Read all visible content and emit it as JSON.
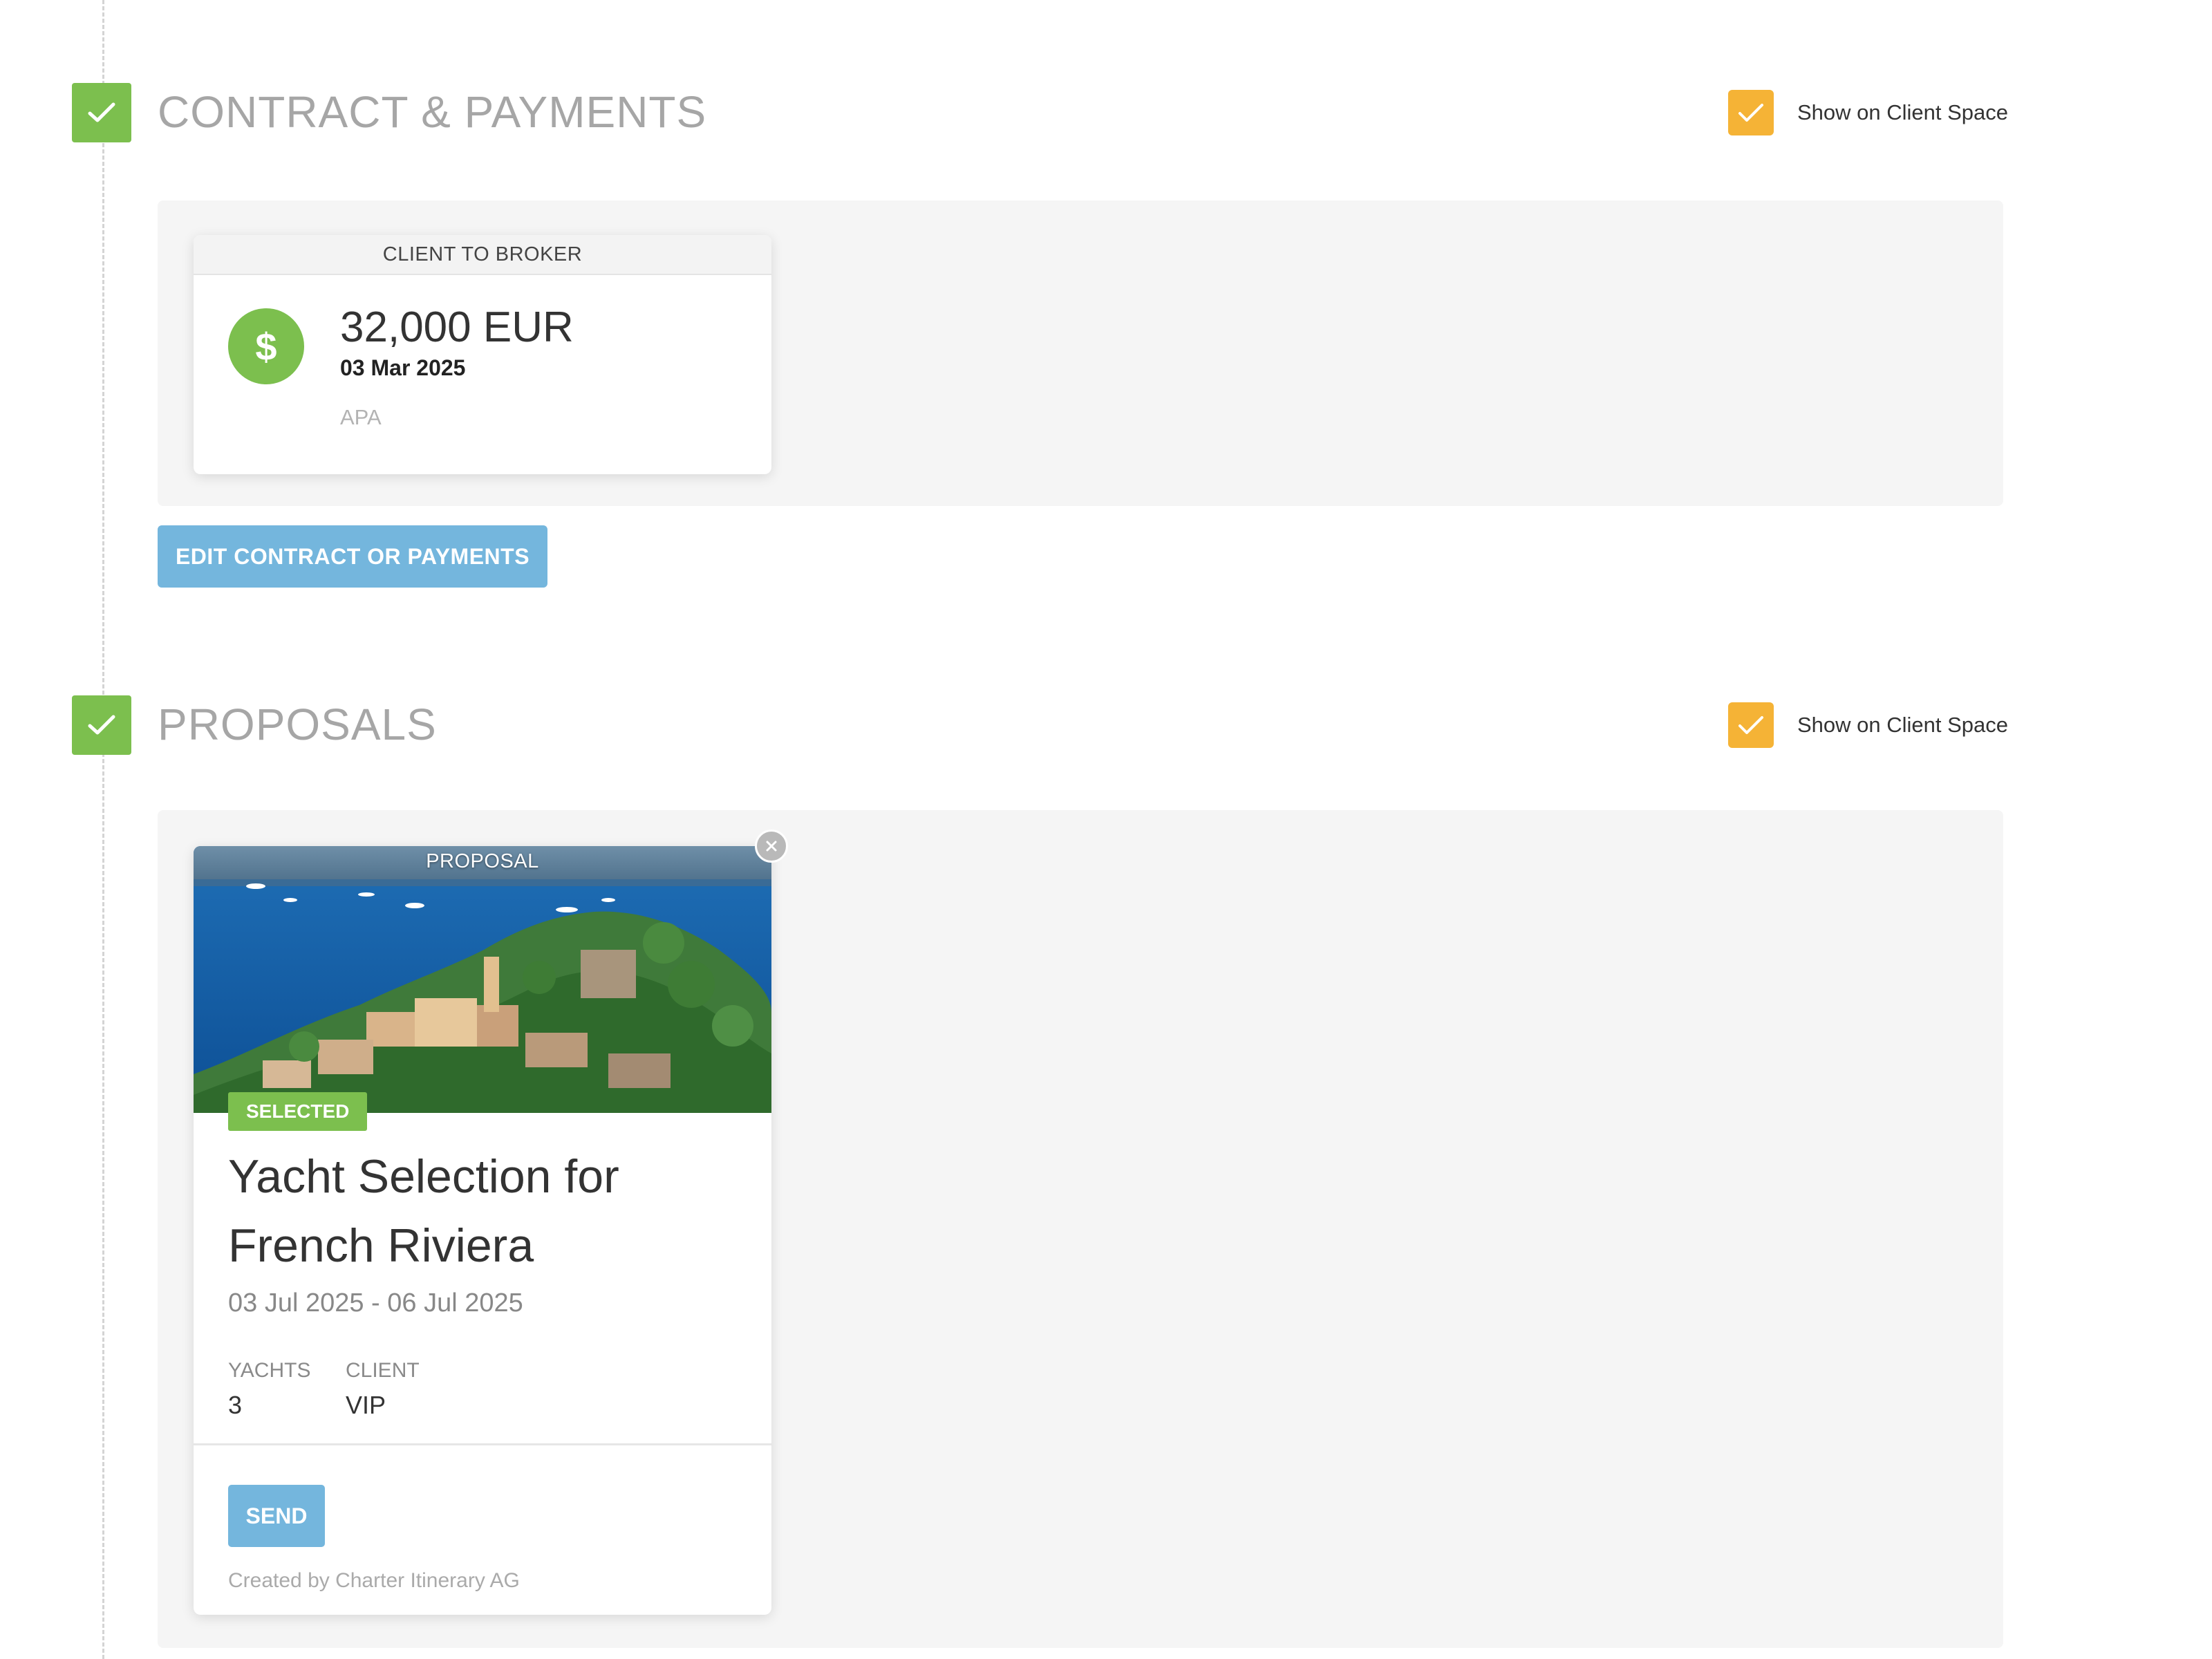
{
  "contract_section": {
    "title": "CONTRACT & PAYMENTS",
    "show_on_client_space_label": "Show on Client Space",
    "payment_card": {
      "header": "CLIENT TO BROKER",
      "amount": "32,000 EUR",
      "date": "03 Mar 2025",
      "type": "APA",
      "icon": "dollar-icon"
    },
    "edit_button_label": "EDIT CONTRACT OR PAYMENTS"
  },
  "proposals_section": {
    "title": "PROPOSALS",
    "show_on_client_space_label": "Show on Client Space",
    "proposal_card": {
      "image_label": "PROPOSAL",
      "badge": "SELECTED",
      "title": "Yacht Selection for French Riviera",
      "dates": "03 Jul 2025 - 06 Jul 2025",
      "yachts_label": "YACHTS",
      "yachts_value": "3",
      "client_label": "CLIENT",
      "client_value": "VIP",
      "send_button_label": "SEND",
      "created_by": "Created by Charter Itinerary AG"
    }
  },
  "colors": {
    "green_check": "#7cbf4e",
    "orange_checkbox": "#f5b336",
    "button_blue": "#74b6dd",
    "panel_bg": "#f5f5f5",
    "section_title": "#a6a6a6"
  }
}
